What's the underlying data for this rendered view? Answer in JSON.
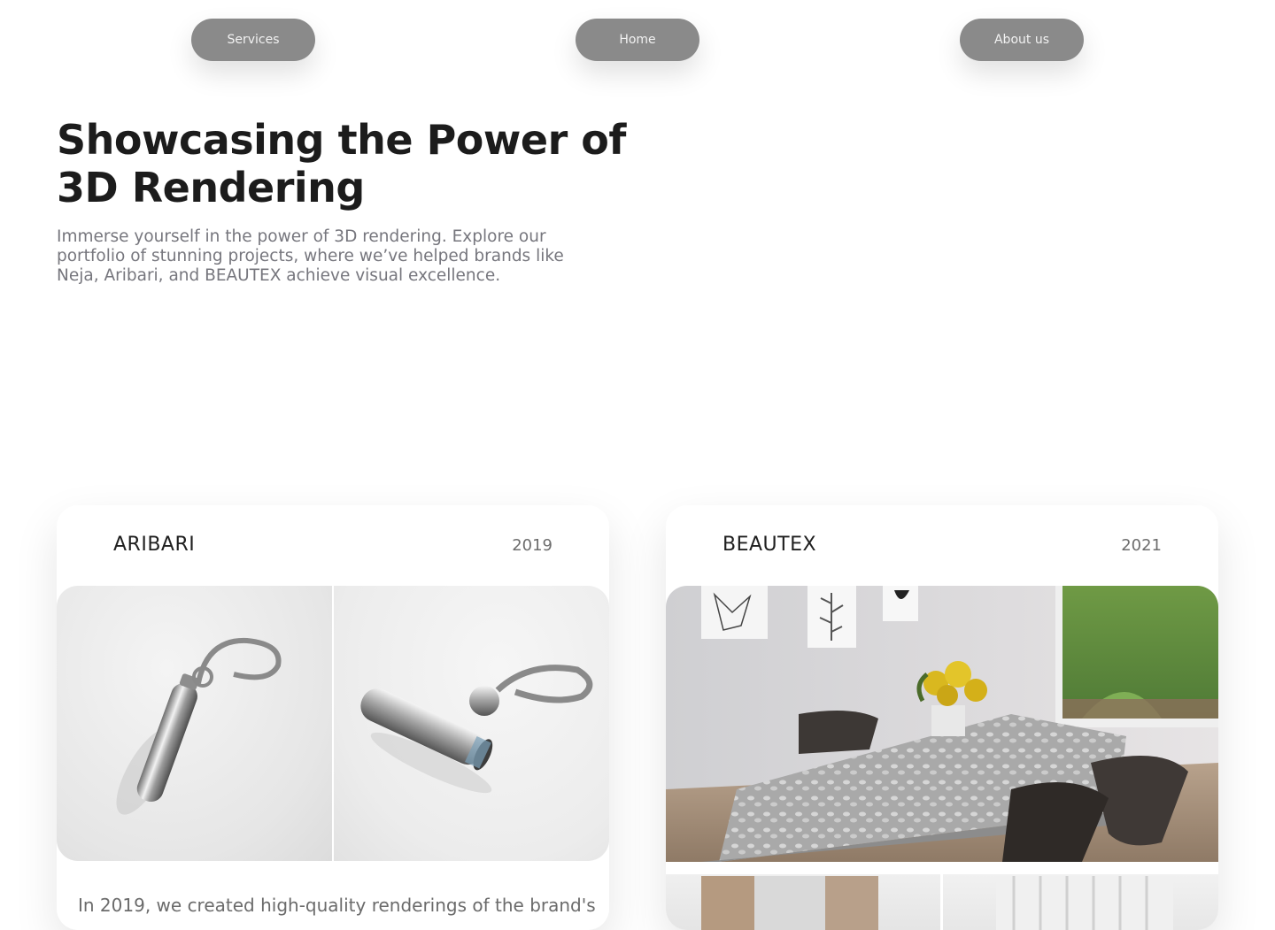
{
  "nav": {
    "items": [
      {
        "label": "Services"
      },
      {
        "label": "Home"
      },
      {
        "label": "About us"
      }
    ]
  },
  "hero": {
    "title_line1": "Showcasing the Power of",
    "title_line2": "3D Rendering",
    "subtitle": "Immerse yourself in the power of 3D rendering. Explore our portfolio of stunning projects, where we’ve helped brands like Neja, Aribari, and BEAUTEX achieve visual excellence."
  },
  "projects": [
    {
      "brand": "ARIBARI",
      "year": "2019",
      "description_partial": "In 2019, we created high-quality renderings of the brand's"
    },
    {
      "brand": "BEAUTEX",
      "year": "2021"
    }
  ],
  "colors": {
    "nav_pill": "#8a8a8a",
    "title": "#1c1c1c",
    "subtitle": "#76767d"
  }
}
